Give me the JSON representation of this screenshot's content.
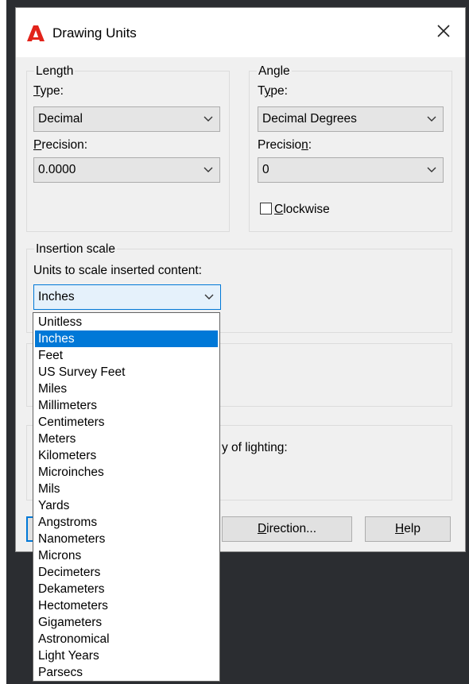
{
  "window": {
    "title": "Drawing Units",
    "logo_icon": "autocad-logo-icon",
    "close_icon": "close-icon"
  },
  "length": {
    "legend": "Length",
    "type_label": {
      "pre": "",
      "mnemonic": "T",
      "post": "ype:"
    },
    "type_value": "Decimal",
    "precision_label": {
      "pre": "",
      "mnemonic": "P",
      "post": "recision:"
    },
    "precision_value": "0.0000"
  },
  "angle": {
    "legend": "Angle",
    "type_label": {
      "pre": "T",
      "mnemonic": "y",
      "post": "pe:"
    },
    "type_value": "Decimal Degrees",
    "precision_label": {
      "pre": "Precisio",
      "mnemonic": "n",
      "post": ":"
    },
    "precision_value": "0",
    "clockwise": {
      "pre": "",
      "mnemonic": "C",
      "post": "lockwise",
      "checked": false
    }
  },
  "insertion_scale": {
    "legend": "Insertion scale",
    "units_label": "Units to scale inserted content:",
    "selected_value": "Inches",
    "options": [
      "Unitless",
      "Inches",
      "Feet",
      "US Survey Feet",
      "Miles",
      "Millimeters",
      "Centimeters",
      "Meters",
      "Kilometers",
      "Microinches",
      "Mils",
      "Yards",
      "Angstroms",
      "Nanometers",
      "Microns",
      "Decimeters",
      "Dekameters",
      "Hectometers",
      "Gigameters",
      "Astronomical",
      "Light Years",
      "Parsecs"
    ],
    "highlighted_index": 1
  },
  "lighting": {
    "label_fragment": "y of lighting:"
  },
  "buttons": {
    "direction": {
      "pre": "",
      "mnemonic": "D",
      "post": "irection..."
    },
    "help": {
      "pre": "",
      "mnemonic": "H",
      "post": "elp"
    }
  },
  "colors": {
    "accent": "#0078d7",
    "dialog_bg": "#f0f0f0",
    "backdrop": "#2b2d31",
    "logo_red": "#e2231a"
  }
}
